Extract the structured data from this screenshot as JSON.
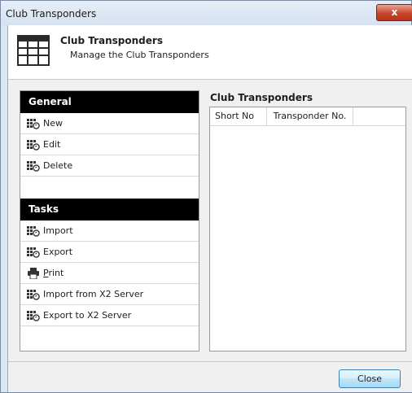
{
  "window": {
    "title": "Club Transponders",
    "close_glyph": "x"
  },
  "header": {
    "title": "Club Transponders",
    "subtitle": "Manage the Club Transponders",
    "icon": "table-icon"
  },
  "left_panel": {
    "general": {
      "heading": "General",
      "items": [
        {
          "label": "New",
          "icon": "table-refresh-icon"
        },
        {
          "label": "Edit",
          "icon": "table-refresh-icon"
        },
        {
          "label": "Delete",
          "icon": "table-refresh-icon"
        }
      ]
    },
    "tasks": {
      "heading": "Tasks",
      "items": [
        {
          "label": "Import",
          "icon": "table-refresh-icon"
        },
        {
          "label": "Export",
          "icon": "table-refresh-icon"
        },
        {
          "label_first": "P",
          "label_rest": "rint",
          "icon": "printer-icon"
        },
        {
          "label": "Import from X2 Server",
          "icon": "table-refresh-icon"
        },
        {
          "label": "Export to X2 Server",
          "icon": "table-refresh-icon"
        }
      ]
    }
  },
  "grid": {
    "title": "Club Transponders",
    "columns": [
      "Short No",
      "Transponder No."
    ],
    "rows": []
  },
  "footer": {
    "close_label": "Close"
  }
}
